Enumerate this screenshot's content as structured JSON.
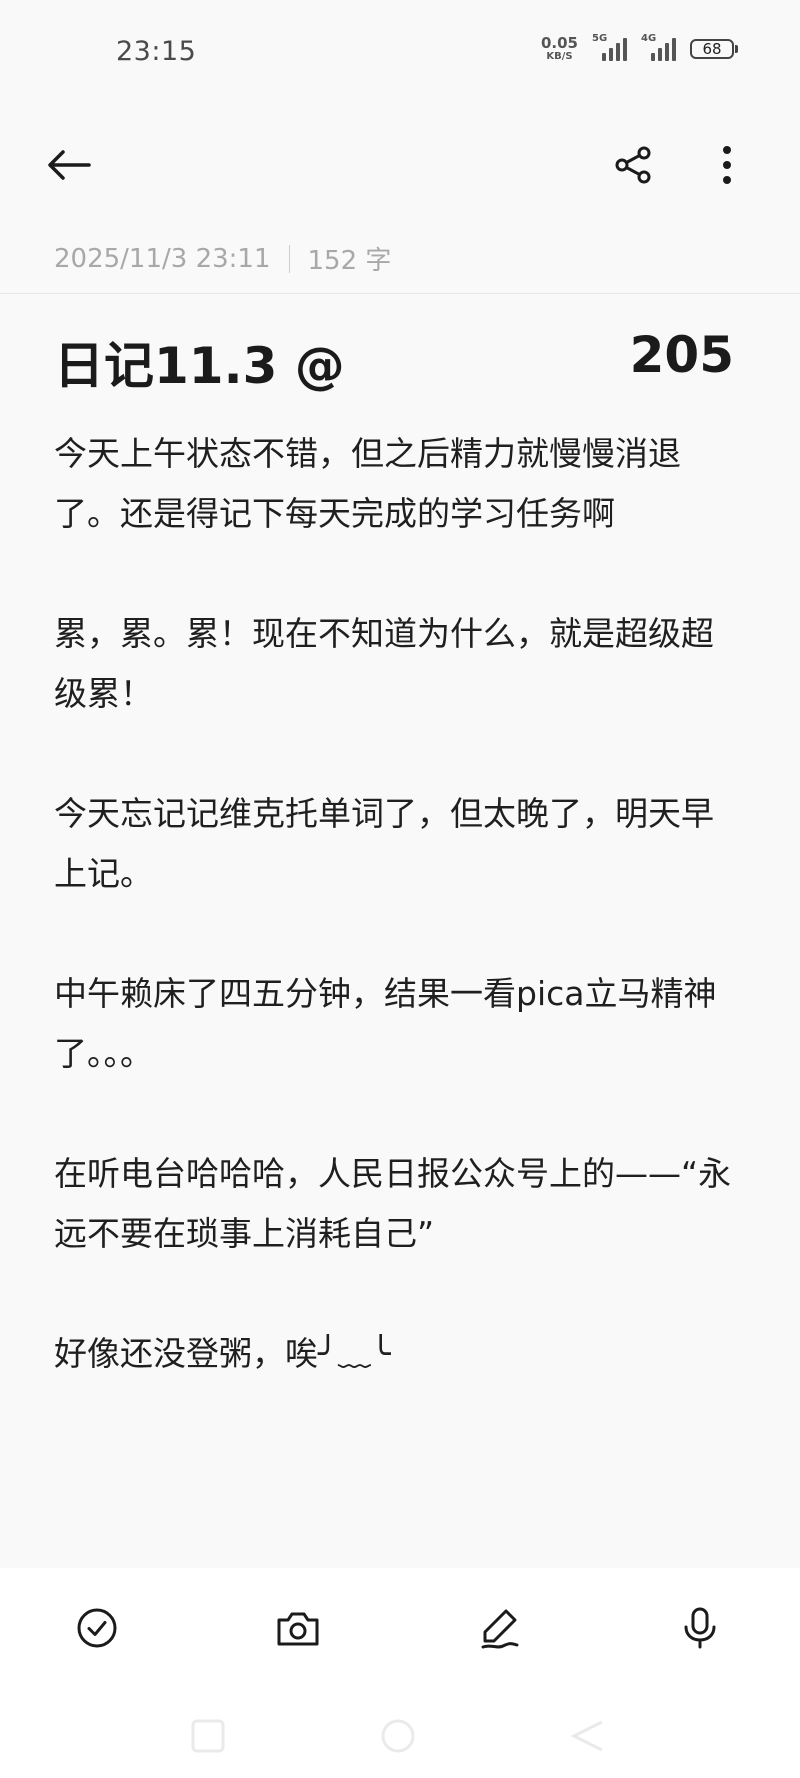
{
  "status_bar": {
    "time": "23:15",
    "net_speed_value": "0.05",
    "net_speed_unit": "KB/S",
    "signal1_label": "5G",
    "signal2_label": "4G",
    "battery": "68"
  },
  "toolbar": {
    "back_icon": "back-arrow-icon",
    "share_icon": "share-icon",
    "more_icon": "more-vertical-icon"
  },
  "note": {
    "date": "2025/11/3 23:11",
    "word_count": "152 字",
    "title": "日记11.3  @",
    "title_number": "205",
    "paragraphs": [
      "今天上午状态不错，但之后精力就慢慢消退了。还是得记下每天完成的学习任务啊",
      "累，累。累！现在不知道为什么，就是超级超级累！",
      "今天忘记记维克托单词了，但太晚了，明天早上记。",
      "中午赖床了四五分钟，结果一看pica立马精神了。。。",
      "在听电台哈哈哈，人民日报公众号上的——“永远不要在琐事上消耗自己”",
      "好像还没登粥，唉╯﹏╰"
    ]
  },
  "bottom_toolbar": {
    "items": [
      "checklist-icon",
      "camera-icon",
      "pen-icon",
      "microphone-icon"
    ]
  },
  "colors": {
    "background": "#f9f9f9",
    "text": "#1b1b1b",
    "meta": "#a8a8a8",
    "bottom_bar": "#ffffff"
  }
}
